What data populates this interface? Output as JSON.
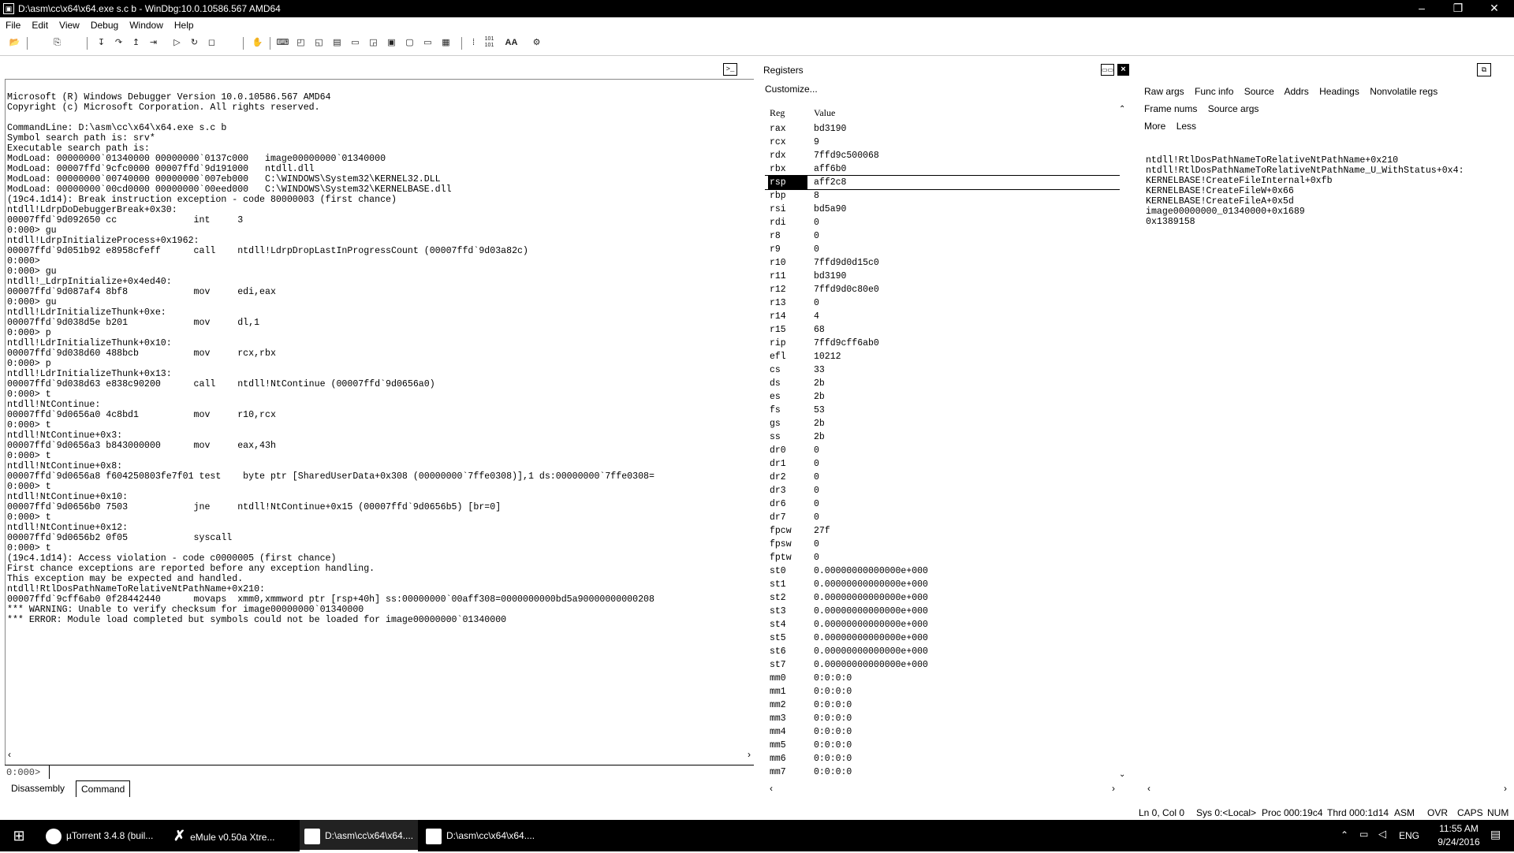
{
  "window": {
    "title": "D:\\asm\\cc\\x64\\x64.exe s.c b - WinDbg:10.0.10586.567 AMD64",
    "app_icon": "windbg-icon",
    "minimize": "–",
    "restore": "❐",
    "close": "✕"
  },
  "menu": [
    "File",
    "Edit",
    "View",
    "Debug",
    "Window",
    "Help"
  ],
  "toolbar": {
    "icons": [
      "open-icon",
      "copy-icon",
      "step-into-icon",
      "step-over-icon",
      "step-out-icon",
      "run-to-cursor-icon",
      "go-icon",
      "restart-icon",
      "stop-icon",
      "break-icon",
      "hand-icon",
      "command-window-icon",
      "watch-icon",
      "locals-icon",
      "registers-icon",
      "memory-icon",
      "call-stack-icon",
      "disassembly-icon",
      "scratchpad-icon",
      "processes-icon",
      "source-mode-icon",
      "hex-icon",
      "font-icon",
      "options-icon"
    ],
    "font_label": "AA",
    "hex_label": "101"
  },
  "command": {
    "output": "Microsoft (R) Windows Debugger Version 10.0.10586.567 AMD64\nCopyright (c) Microsoft Corporation. All rights reserved.\n\nCommandLine: D:\\asm\\cc\\x64\\x64.exe s.c b\nSymbol search path is: srv*\nExecutable search path is:\nModLoad: 00000000`01340000 00000000`0137c000   image00000000`01340000\nModLoad: 00007ffd`9cfc0000 00007ffd`9d191000   ntdll.dll\nModLoad: 00000000`00740000 00000000`007eb000   C:\\WINDOWS\\System32\\KERNEL32.DLL\nModLoad: 00000000`00cd0000 00000000`00eed000   C:\\WINDOWS\\System32\\KERNELBASE.dll\n(19c4.1d14): Break instruction exception - code 80000003 (first chance)\nntdll!LdrpDoDebuggerBreak+0x30:\n00007ffd`9d092650 cc              int     3\n0:000> gu\nntdll!LdrpInitializeProcess+0x1962:\n00007ffd`9d051b92 e8958cfeff      call    ntdll!LdrpDropLastInProgressCount (00007ffd`9d03a82c)\n0:000>\n0:000> gu\nntdll!_LdrpInitialize+0x4ed40:\n00007ffd`9d087af4 8bf8            mov     edi,eax\n0:000> gu\nntdll!LdrInitializeThunk+0xe:\n00007ffd`9d038d5e b201            mov     dl,1\n0:000> p\nntdll!LdrInitializeThunk+0x10:\n00007ffd`9d038d60 488bcb          mov     rcx,rbx\n0:000> p\nntdll!LdrInitializeThunk+0x13:\n00007ffd`9d038d63 e838c90200      call    ntdll!NtContinue (00007ffd`9d0656a0)\n0:000> t\nntdll!NtContinue:\n00007ffd`9d0656a0 4c8bd1          mov     r10,rcx\n0:000> t\nntdll!NtContinue+0x3:\n00007ffd`9d0656a3 b843000000      mov     eax,43h\n0:000> t\nntdll!NtContinue+0x8:\n00007ffd`9d0656a8 f604250803fe7f01 test    byte ptr [SharedUserData+0x308 (00000000`7ffe0308)],1 ds:00000000`7ffe0308=\n0:000> t\nntdll!NtContinue+0x10:\n00007ffd`9d0656b0 7503            jne     ntdll!NtContinue+0x15 (00007ffd`9d0656b5) [br=0]\n0:000> t\nntdll!NtContinue+0x12:\n00007ffd`9d0656b2 0f05            syscall\n0:000> t\n(19c4.1d14): Access violation - code c0000005 (first chance)\nFirst chance exceptions are reported before any exception handling.\nThis exception may be expected and handled.\nntdll!RtlDosPathNameToRelativeNtPathName+0x210:\n00007ffd`9cff6ab0 0f28442440      movaps  xmm0,xmmword ptr [rsp+40h] ss:00000000`00aff308=0000000000bd5a90000000000208\n*** WARNING: Unable to verify checksum for image00000000`01340000\n*** ERROR: Module load completed but symbols could not be loaded for image00000000`01340000",
    "prompt": "0:000>",
    "input_value": "",
    "pane_icon": "command-prompt-icon",
    "scroll_left": "‹",
    "scroll_right": "›"
  },
  "tabs": [
    "Disassembly",
    "Command"
  ],
  "active_tab": "Command",
  "registers": {
    "title": "Registers",
    "customize": "Customize...",
    "col_reg": "Reg",
    "col_value": "Value",
    "selected": "rsp",
    "rows": [
      {
        "reg": "rax",
        "value": "bd3190"
      },
      {
        "reg": "rcx",
        "value": "9"
      },
      {
        "reg": "rdx",
        "value": "7ffd9c500068"
      },
      {
        "reg": "rbx",
        "value": "aff6b0"
      },
      {
        "reg": "rsp",
        "value": "aff2c8"
      },
      {
        "reg": "rbp",
        "value": "8"
      },
      {
        "reg": "rsi",
        "value": "bd5a90"
      },
      {
        "reg": "rdi",
        "value": "0"
      },
      {
        "reg": "r8",
        "value": "0"
      },
      {
        "reg": "r9",
        "value": "0"
      },
      {
        "reg": "r10",
        "value": "7ffd9d0d15c0"
      },
      {
        "reg": "r11",
        "value": "bd3190"
      },
      {
        "reg": "r12",
        "value": "7ffd9d0c80e0"
      },
      {
        "reg": "r13",
        "value": "0"
      },
      {
        "reg": "r14",
        "value": "4"
      },
      {
        "reg": "r15",
        "value": "68"
      },
      {
        "reg": "rip",
        "value": "7ffd9cff6ab0"
      },
      {
        "reg": "efl",
        "value": "10212"
      },
      {
        "reg": "cs",
        "value": "33"
      },
      {
        "reg": "ds",
        "value": "2b"
      },
      {
        "reg": "es",
        "value": "2b"
      },
      {
        "reg": "fs",
        "value": "53"
      },
      {
        "reg": "gs",
        "value": "2b"
      },
      {
        "reg": "ss",
        "value": "2b"
      },
      {
        "reg": "dr0",
        "value": "0"
      },
      {
        "reg": "dr1",
        "value": "0"
      },
      {
        "reg": "dr2",
        "value": "0"
      },
      {
        "reg": "dr3",
        "value": "0"
      },
      {
        "reg": "dr6",
        "value": "0"
      },
      {
        "reg": "dr7",
        "value": "0"
      },
      {
        "reg": "fpcw",
        "value": "27f"
      },
      {
        "reg": "fpsw",
        "value": "0"
      },
      {
        "reg": "fptw",
        "value": "0"
      },
      {
        "reg": "st0",
        "value": " 0.00000000000000e+000"
      },
      {
        "reg": "st1",
        "value": " 0.00000000000000e+000"
      },
      {
        "reg": "st2",
        "value": " 0.00000000000000e+000"
      },
      {
        "reg": "st3",
        "value": " 0.00000000000000e+000"
      },
      {
        "reg": "st4",
        "value": " 0.00000000000000e+000"
      },
      {
        "reg": "st5",
        "value": " 0.00000000000000e+000"
      },
      {
        "reg": "st6",
        "value": " 0.00000000000000e+000"
      },
      {
        "reg": "st7",
        "value": " 0.00000000000000e+000"
      },
      {
        "reg": "mm0",
        "value": "0:0:0:0"
      },
      {
        "reg": "mm1",
        "value": "0:0:0:0"
      },
      {
        "reg": "mm2",
        "value": "0:0:0:0"
      },
      {
        "reg": "mm3",
        "value": "0:0:0:0"
      },
      {
        "reg": "mm4",
        "value": "0:0:0:0"
      },
      {
        "reg": "mm5",
        "value": "0:0:0:0"
      },
      {
        "reg": "mm6",
        "value": "0:0:0:0"
      },
      {
        "reg": "mm7",
        "value": "0:0:0:0"
      }
    ],
    "scroll_up": "⌃",
    "scroll_down": "⌄",
    "scroll_left": "‹",
    "scroll_right": "›"
  },
  "callstack": {
    "options": [
      "Raw args",
      "Func info",
      "Source",
      "Addrs",
      "Headings",
      "Nonvolatile regs",
      "Frame nums",
      "Source args"
    ],
    "more": "More",
    "less": "Less",
    "frames": [
      "ntdll!RtlDosPathNameToRelativeNtPathName+0x210",
      "ntdll!RtlDosPathNameToRelativeNtPathName_U_WithStatus+0x4:",
      "KERNELBASE!CreateFileInternal+0xfb",
      "KERNELBASE!CreateFileW+0x66",
      "KERNELBASE!CreateFileA+0x5d",
      "image00000000_01340000+0x1689",
      "0x1389158"
    ],
    "scroll_left": "‹",
    "scroll_right": "›"
  },
  "status": {
    "ln_col": "Ln 0, Col 0",
    "sys": "Sys 0:<Local>",
    "proc": "Proc 000:19c4",
    "thrd": "Thrd 000:1d14",
    "asm": "ASM",
    "ovr": "OVR",
    "caps": "CAPS",
    "num": "NUM"
  },
  "taskbar": {
    "start": "start-icon",
    "items": [
      {
        "label": "µTorrent 3.4.8  (buil...",
        "icon": "utorrent-icon"
      },
      {
        "label": "eMule v0.50a Xtre...",
        "icon": "emule-icon"
      },
      {
        "label": "D:\\asm\\cc\\x64\\x64....",
        "icon": "windbg-icon"
      },
      {
        "label": "D:\\asm\\cc\\x64\\x64....",
        "icon": "console-icon"
      }
    ],
    "lang": "ENG",
    "time": "11:55 AM",
    "date": "9/24/2016"
  }
}
